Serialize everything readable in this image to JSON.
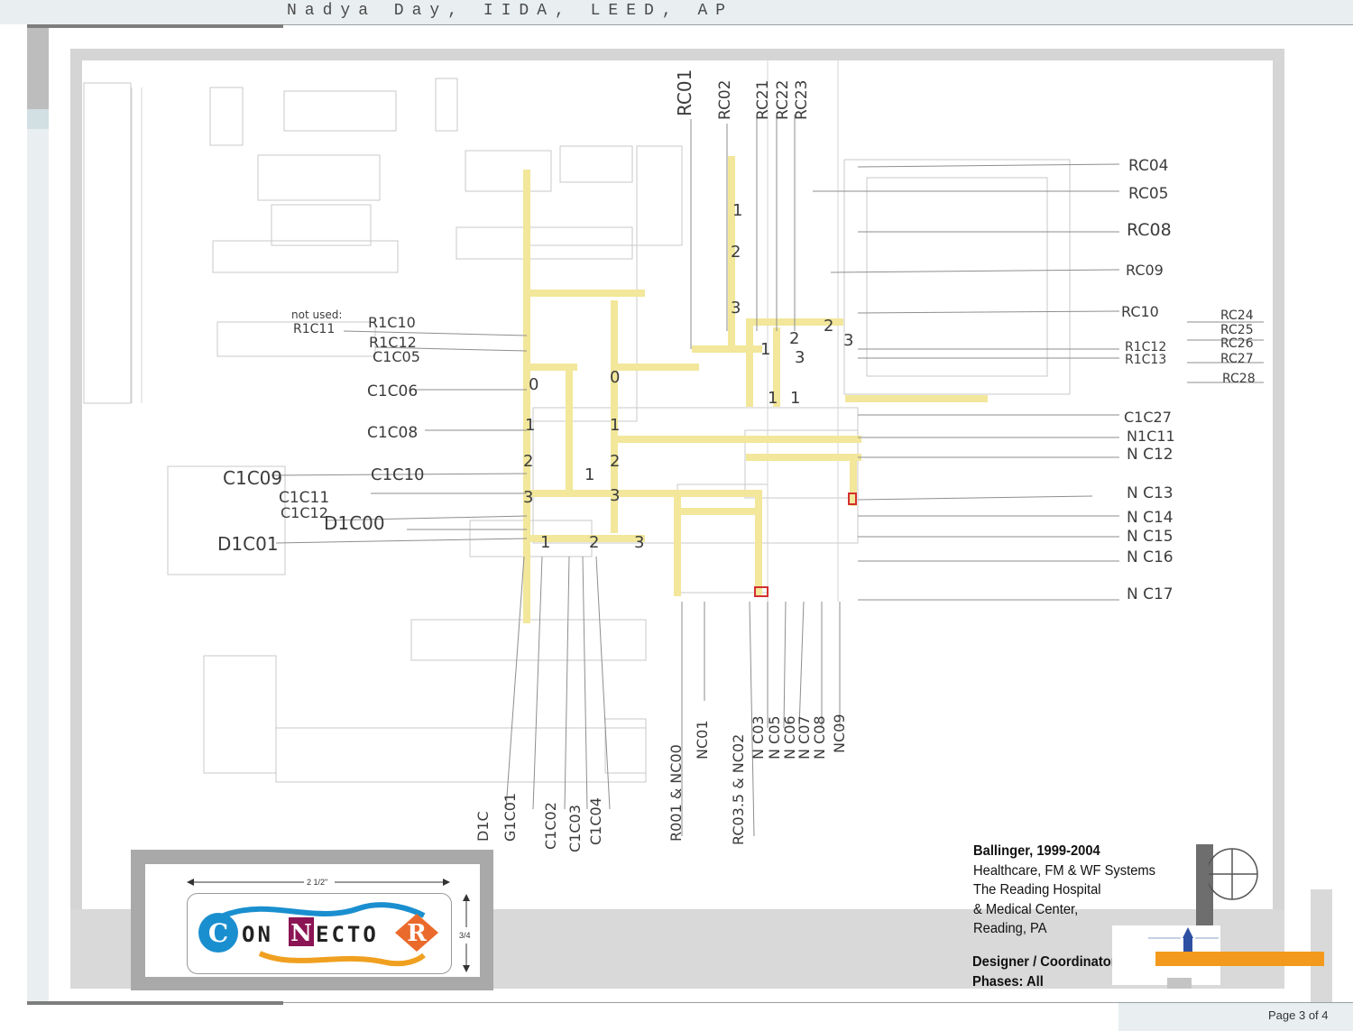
{
  "header": {
    "title": "Nadya Day, IIDA, LEED, AP"
  },
  "plan": {
    "labels_top": [
      "RC01",
      "RC02",
      "RC21",
      "RC22",
      "RC23"
    ],
    "labels_right": [
      "RC04",
      "RC05",
      "RC08",
      "RC09",
      "RC10",
      "R1C12",
      "R1C13",
      "C1C27",
      "N1C11",
      "N C12",
      "N C13",
      "N C14",
      "N C15",
      "N C16",
      "N C17"
    ],
    "labels_far_right": [
      "RC24",
      "RC25",
      "RC26",
      "RC27",
      "RC28"
    ],
    "labels_left": [
      "not used:",
      "R1C11",
      "R1C10",
      "R1C12",
      "C1C05",
      "C1C06",
      "C1C08",
      "C1C09",
      "C1C10",
      "C1C11",
      "C1C12",
      "D1C00",
      "D1C01"
    ],
    "labels_bottom": [
      "D1C",
      "G1C01",
      "C1C02",
      "C1C03",
      "C1C04",
      "R001 & NC00",
      "NC01",
      "RC03.5 & NC02",
      "N C03",
      "N C05",
      "N C06",
      "N C07",
      "N C08",
      "NC09"
    ],
    "numbers": [
      "0",
      "1",
      "2",
      "3",
      "0",
      "1",
      "2",
      "3",
      "1",
      "1",
      "2",
      "3",
      "1",
      "2",
      "3",
      "1",
      "2",
      "3",
      "2",
      "3",
      "1",
      "1"
    ]
  },
  "logo": {
    "dimension_width": "2 1/2\"",
    "dimension_height": "3/4",
    "letters": [
      "C",
      "ON",
      "N",
      "ECTO",
      "R"
    ],
    "colors": {
      "c_circle": "#1a8fcf",
      "n_square": "#8b1454",
      "r_badge": "#ea6a2c",
      "swoosh_blue": "#1a8fcf",
      "swoosh_orange": "#f0a020"
    }
  },
  "project": {
    "line1": "Ballinger, 1999-2004",
    "line2": "Healthcare, FM & WF Systems",
    "line3": "The Reading Hospital",
    "line4": "& Medical Center,",
    "line5": "Reading, PA",
    "role": "Designer / Coordinator",
    "phases": "Phases: All"
  },
  "footer": {
    "page": "Page 3 of 4"
  },
  "colors": {
    "highlight": "#f2e79a",
    "accent_orange": "#f39a1e",
    "frame_grey": "#d5d5d5"
  }
}
